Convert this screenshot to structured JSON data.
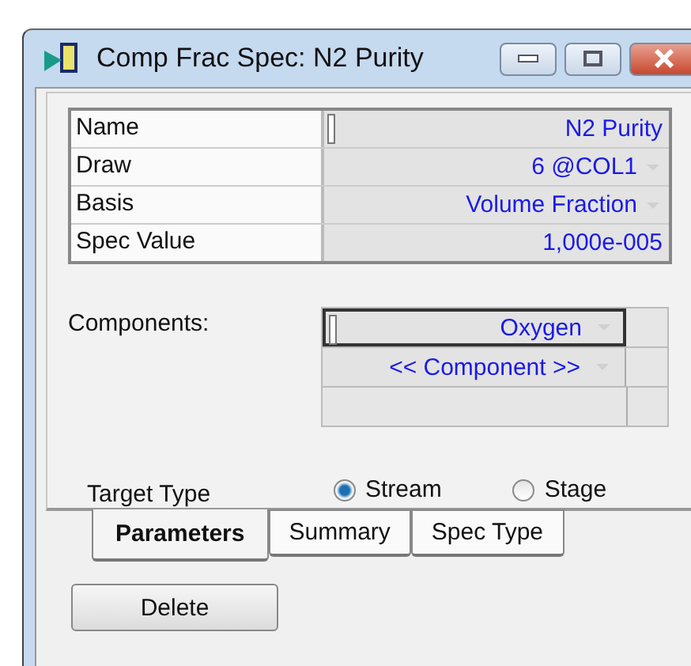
{
  "window": {
    "title": "Comp Frac Spec: N2 Purity"
  },
  "parameters": [
    {
      "label": "Name",
      "value": "N2 Purity",
      "kind": "text",
      "editing": true
    },
    {
      "label": "Draw",
      "value": "6 @COL1",
      "kind": "dropdown",
      "editing": false
    },
    {
      "label": "Basis",
      "value": "Volume Fraction",
      "kind": "dropdown",
      "editing": false
    },
    {
      "label": "Spec Value",
      "value": "1,000e-005",
      "kind": "text",
      "editing": false
    }
  ],
  "components": {
    "label": "Components:",
    "rows": [
      {
        "value": "Oxygen",
        "selected": true
      },
      {
        "value": "<< Component >>",
        "selected": false
      }
    ]
  },
  "target_type": {
    "label": "Target Type",
    "options": [
      {
        "label": "Stream",
        "selected": true
      },
      {
        "label": "Stage",
        "selected": false
      }
    ]
  },
  "tabs": [
    {
      "label": "Parameters",
      "selected": true
    },
    {
      "label": "Summary",
      "selected": false
    },
    {
      "label": "Spec Type",
      "selected": false
    }
  ],
  "buttons": [
    "Delete"
  ]
}
